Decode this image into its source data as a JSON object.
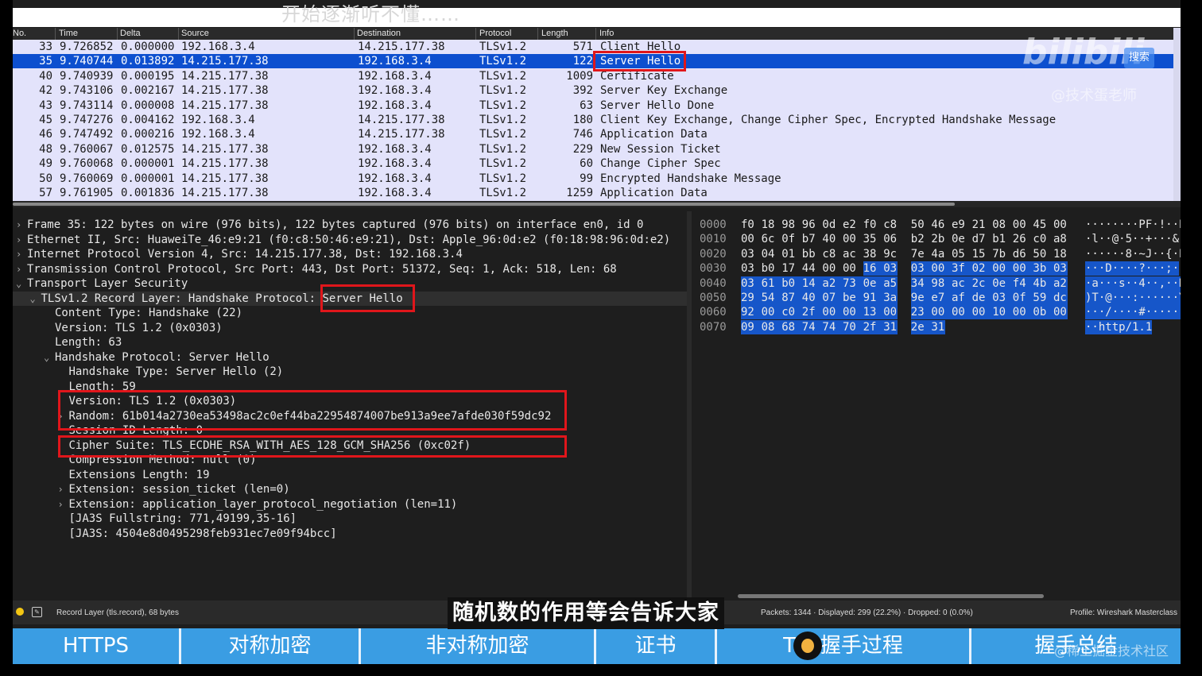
{
  "top_ghost_text": "开始逐渐听不懂……",
  "columns": [
    "No.",
    "Time",
    "Delta",
    "Source",
    "Destination",
    "Protocol",
    "Length",
    "Info"
  ],
  "packets": [
    {
      "no": "33",
      "time": "9.726852",
      "delta": "0.000000",
      "src": "192.168.3.4",
      "dst": "14.215.177.38",
      "proto": "TLSv1.2",
      "len": "571",
      "info": "Client Hello"
    },
    {
      "no": "35",
      "time": "9.740744",
      "delta": "0.013892",
      "src": "14.215.177.38",
      "dst": "192.168.3.4",
      "proto": "TLSv1.2",
      "len": "122",
      "info": "Server Hello"
    },
    {
      "no": "40",
      "time": "9.740939",
      "delta": "0.000195",
      "src": "14.215.177.38",
      "dst": "192.168.3.4",
      "proto": "TLSv1.2",
      "len": "1009",
      "info": "Certificate"
    },
    {
      "no": "42",
      "time": "9.743106",
      "delta": "0.002167",
      "src": "14.215.177.38",
      "dst": "192.168.3.4",
      "proto": "TLSv1.2",
      "len": "392",
      "info": "Server Key Exchange"
    },
    {
      "no": "43",
      "time": "9.743114",
      "delta": "0.000008",
      "src": "14.215.177.38",
      "dst": "192.168.3.4",
      "proto": "TLSv1.2",
      "len": "63",
      "info": "Server Hello Done"
    },
    {
      "no": "45",
      "time": "9.747276",
      "delta": "0.004162",
      "src": "192.168.3.4",
      "dst": "14.215.177.38",
      "proto": "TLSv1.2",
      "len": "180",
      "info": "Client Key Exchange, Change Cipher Spec, Encrypted Handshake Message"
    },
    {
      "no": "46",
      "time": "9.747492",
      "delta": "0.000216",
      "src": "192.168.3.4",
      "dst": "14.215.177.38",
      "proto": "TLSv1.2",
      "len": "746",
      "info": "Application Data"
    },
    {
      "no": "48",
      "time": "9.760067",
      "delta": "0.012575",
      "src": "14.215.177.38",
      "dst": "192.168.3.4",
      "proto": "TLSv1.2",
      "len": "229",
      "info": "New Session Ticket"
    },
    {
      "no": "49",
      "time": "9.760068",
      "delta": "0.000001",
      "src": "14.215.177.38",
      "dst": "192.168.3.4",
      "proto": "TLSv1.2",
      "len": "60",
      "info": "Change Cipher Spec"
    },
    {
      "no": "50",
      "time": "9.760069",
      "delta": "0.000001",
      "src": "14.215.177.38",
      "dst": "192.168.3.4",
      "proto": "TLSv1.2",
      "len": "99",
      "info": "Encrypted Handshake Message"
    },
    {
      "no": "57",
      "time": "9.761905",
      "delta": "0.001836",
      "src": "14.215.177.38",
      "dst": "192.168.3.4",
      "proto": "TLSv1.2",
      "len": "1259",
      "info": "Application Data"
    }
  ],
  "selected_packet_index": 1,
  "details": [
    {
      "indent": 0,
      "arrow": "›",
      "text": "Frame 35: 122 bytes on wire (976 bits), 122 bytes captured (976 bits) on interface en0, id 0"
    },
    {
      "indent": 0,
      "arrow": "›",
      "text": "Ethernet II, Src: HuaweiTe_46:e9:21 (f0:c8:50:46:e9:21), Dst: Apple_96:0d:e2 (f0:18:98:96:0d:e2)"
    },
    {
      "indent": 0,
      "arrow": "›",
      "text": "Internet Protocol Version 4, Src: 14.215.177.38, Dst: 192.168.3.4"
    },
    {
      "indent": 0,
      "arrow": "›",
      "text": "Transmission Control Protocol, Src Port: 443, Dst Port: 51372, Seq: 1, Ack: 518, Len: 68"
    },
    {
      "indent": 0,
      "arrow": "⌄",
      "text": "Transport Layer Security"
    },
    {
      "indent": 1,
      "arrow": "⌄",
      "text": "TLSv1.2 Record Layer: Handshake Protocol: Server Hello"
    },
    {
      "indent": 2,
      "arrow": "",
      "text": "Content Type: Handshake (22)"
    },
    {
      "indent": 2,
      "arrow": "",
      "text": "Version: TLS 1.2 (0x0303)"
    },
    {
      "indent": 2,
      "arrow": "",
      "text": "Length: 63"
    },
    {
      "indent": 2,
      "arrow": "⌄",
      "text": "Handshake Protocol: Server Hello"
    },
    {
      "indent": 3,
      "arrow": "",
      "text": "Handshake Type: Server Hello (2)"
    },
    {
      "indent": 3,
      "arrow": "",
      "text": "Length: 59"
    },
    {
      "indent": 3,
      "arrow": "",
      "text": "Version: TLS 1.2 (0x0303)"
    },
    {
      "indent": 3,
      "arrow": "›",
      "text": "Random: 61b014a2730ea53498ac2c0ef44ba22954874007be913a9ee7afde030f59dc92"
    },
    {
      "indent": 3,
      "arrow": "",
      "text": "Session ID Length: 0"
    },
    {
      "indent": 3,
      "arrow": "",
      "text": "Cipher Suite: TLS_ECDHE_RSA_WITH_AES_128_GCM_SHA256 (0xc02f)"
    },
    {
      "indent": 3,
      "arrow": "",
      "text": "Compression Method: null (0)"
    },
    {
      "indent": 3,
      "arrow": "",
      "text": "Extensions Length: 19"
    },
    {
      "indent": 3,
      "arrow": "›",
      "text": "Extension: session_ticket (len=0)"
    },
    {
      "indent": 3,
      "arrow": "›",
      "text": "Extension: application_layer_protocol_negotiation (len=11)"
    },
    {
      "indent": 3,
      "arrow": "",
      "text": "[JA3S Fullstring: 771,49199,35-16]"
    },
    {
      "indent": 3,
      "arrow": "",
      "text": "[JA3S: 4504e8d0495298feb931ec7e09f94bcc]"
    }
  ],
  "hex_rows": [
    {
      "offset": "0000",
      "bytes": [
        "f0",
        "18",
        "98",
        "96",
        "0d",
        "e2",
        "f0",
        "c8",
        "50",
        "46",
        "e9",
        "21",
        "08",
        "00",
        "45",
        "00"
      ],
      "ascii": "········PF·!··E·"
    },
    {
      "offset": "0010",
      "bytes": [
        "00",
        "6c",
        "0f",
        "b7",
        "40",
        "00",
        "35",
        "06",
        "b2",
        "2b",
        "0e",
        "d7",
        "b1",
        "26",
        "c0",
        "a8"
      ],
      "ascii": "·l··@·5··+···&··"
    },
    {
      "offset": "0020",
      "bytes": [
        "03",
        "04",
        "01",
        "bb",
        "c8",
        "ac",
        "38",
        "9c",
        "7e",
        "4a",
        "05",
        "15",
        "7b",
        "d6",
        "50",
        "18"
      ],
      "ascii": "······8·~J··{·P·"
    },
    {
      "offset": "0030",
      "bytes": [
        "03",
        "b0",
        "17",
        "44",
        "00",
        "00",
        "16",
        "03",
        "03",
        "00",
        "3f",
        "02",
        "00",
        "00",
        "3b",
        "03"
      ],
      "ascii": "···D····?···;·"
    },
    {
      "offset": "0040",
      "bytes": [
        "03",
        "61",
        "b0",
        "14",
        "a2",
        "73",
        "0e",
        "a5",
        "34",
        "98",
        "ac",
        "2c",
        "0e",
        "f4",
        "4b",
        "a2"
      ],
      "ascii": "·a···s··4··,··K·"
    },
    {
      "offset": "0050",
      "bytes": [
        "29",
        "54",
        "87",
        "40",
        "07",
        "be",
        "91",
        "3a",
        "9e",
        "e7",
        "af",
        "de",
        "03",
        "0f",
        "59",
        "dc"
      ],
      "ascii": ")T·@···:······Y·"
    },
    {
      "offset": "0060",
      "bytes": [
        "92",
        "00",
        "c0",
        "2f",
        "00",
        "00",
        "13",
        "00",
        "23",
        "00",
        "00",
        "00",
        "10",
        "00",
        "0b",
        "00"
      ],
      "ascii": "···/····#·······"
    },
    {
      "offset": "0070",
      "bytes": [
        "09",
        "08",
        "68",
        "74",
        "74",
        "70",
        "2f",
        "31",
        "2e",
        "31"
      ],
      "ascii": "··http/1.1"
    }
  ],
  "hex_selection_start": 54,
  "watermark": {
    "logo": "bilibili",
    "badge": "搜索",
    "user": "@技术蛋老师"
  },
  "status": {
    "record": "Record Layer (tls.record), 68 bytes",
    "packets": "Packets: 1344 · Displayed: 299 (22.2%) · Dropped: 0 (0.0%)",
    "profile": "Profile: Wireshark Masterclass"
  },
  "subtitle": "随机数的作用等会告诉大家",
  "nav_tabs": [
    "HTTPS",
    "对称加密",
    "非对称加密",
    "证书",
    "TLS握手过程",
    "握手总结"
  ],
  "nav_watermark": "@稀土掘金技术社区",
  "colors": {
    "selected_row": "#0d4fcf",
    "highlight_box": "#e0161b",
    "nav_bg": "#3a9de3",
    "list_bg": "#e3e3fb"
  }
}
